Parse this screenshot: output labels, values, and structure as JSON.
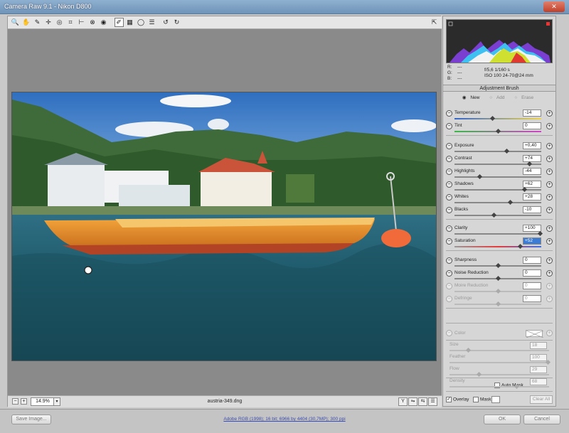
{
  "window": {
    "title": "Camera Raw 9.1  -  Nikon D800",
    "close": "✕"
  },
  "toolbar": {
    "tools": [
      "zoom-tool-icon",
      "hand-tool-icon",
      "white-balance-tool-icon",
      "color-sampler-icon",
      "targeted-adjustment-icon",
      "crop-tool-icon",
      "straighten-tool-icon",
      "spot-removal-icon",
      "red-eye-icon",
      "adjustment-brush-icon",
      "graduated-filter-icon",
      "radial-filter-icon",
      "preferences-icon",
      "rotate-ccw-icon",
      "rotate-cw-icon"
    ],
    "glyphs": [
      "🔍",
      "✋",
      "✎",
      "✛",
      "◎",
      "⌗",
      "⊢",
      "⊗",
      "◉",
      "✐",
      "▦",
      "◯",
      "☰",
      "↺",
      "↻"
    ],
    "fullscreen": "⇱"
  },
  "status": {
    "zoom": "14.9%",
    "filename": "austria-349.dng",
    "view_buttons": [
      "Y",
      "⇋",
      "⇆",
      "☰"
    ]
  },
  "info": {
    "r_label": "R:",
    "g_label": "G:",
    "b_label": "B:",
    "r": "---",
    "g": "---",
    "b": "---",
    "line1": "f/5,6   1/160 s",
    "line2": "ISO 100   24-70@24 mm"
  },
  "panel": {
    "title": "Adjustment Brush",
    "modes": {
      "new": "New",
      "add": "Add",
      "erase": "Erase"
    },
    "sliders": [
      {
        "label": "Temperature",
        "value": "-14",
        "pos": 0.43,
        "track": "temp"
      },
      {
        "label": "Tint",
        "value": "0",
        "pos": 0.5,
        "track": "tint"
      },
      {
        "label": "Exposure",
        "value": "+0,40",
        "pos": 0.6
      },
      {
        "label": "Contrast",
        "value": "+74",
        "pos": 0.87
      },
      {
        "label": "Highlights",
        "value": "-44",
        "pos": 0.28
      },
      {
        "label": "Shadows",
        "value": "+62",
        "pos": 0.81
      },
      {
        "label": "Whites",
        "value": "+28",
        "pos": 0.64
      },
      {
        "label": "Blacks",
        "value": "-10",
        "pos": 0.45
      },
      {
        "label": "Clarity",
        "value": "+100",
        "pos": 1.0
      },
      {
        "label": "Saturation",
        "value": "+52",
        "pos": 0.76,
        "track": "sat",
        "selected": true
      },
      {
        "label": "Sharpness",
        "value": "0",
        "pos": 0.5
      },
      {
        "label": "Noise Reduction",
        "value": "0",
        "pos": 0.5
      },
      {
        "label": "Moire Reduction",
        "value": "0",
        "pos": 0.5,
        "disabled": true
      },
      {
        "label": "Defringe",
        "value": "0",
        "pos": 0.5,
        "disabled": true
      }
    ],
    "color_label": "Color",
    "brush": [
      {
        "label": "Size",
        "value": "18",
        "pos": 0.18
      },
      {
        "label": "Feather",
        "value": "100",
        "pos": 1.0
      },
      {
        "label": "Flow",
        "value": "29",
        "pos": 0.29
      },
      {
        "label": "Density",
        "value": "68",
        "pos": 0.68
      }
    ],
    "auto_mask": "Auto Mask",
    "overlay": "Overlay",
    "mask": "Mask",
    "clear_all": "Clear All"
  },
  "bottom": {
    "save_image": "Save Image...",
    "workflow": "Adobe RGB (1998); 16 bit; 6966 by 4404 (30,7MP); 300 ppi",
    "ok": "OK",
    "cancel": "Cancel"
  }
}
